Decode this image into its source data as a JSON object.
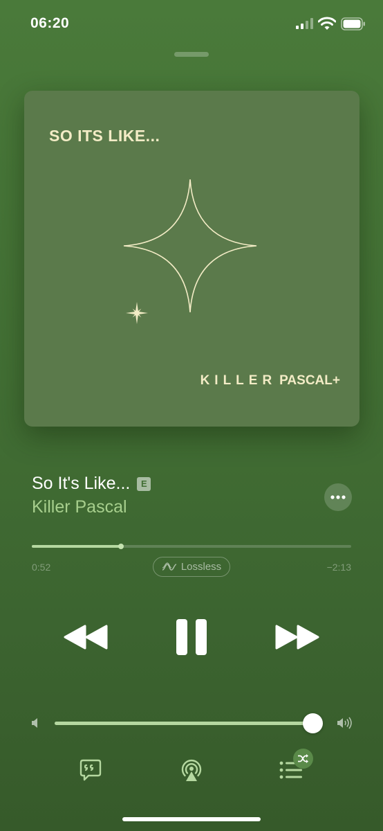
{
  "status_bar": {
    "time": "06:20",
    "icons": [
      "cellular-signal-icon",
      "wifi-icon",
      "battery-icon"
    ]
  },
  "artwork": {
    "title": "SO ITS LIKE...",
    "artist_part1": "KILLER",
    "artist_part2": "PASCAL",
    "artist_suffix": "+",
    "background_color": "#5b7a4b",
    "text_color": "#f3ecc6"
  },
  "track": {
    "title": "So It's Like...",
    "explicit_label": "E",
    "artist": "Killer Pascal"
  },
  "playback": {
    "elapsed": "0:52",
    "remaining": "−2:13",
    "progress_fraction": 0.28,
    "quality_label": "Lossless"
  },
  "volume": {
    "level_fraction": 0.995
  },
  "controls": {
    "icons": [
      "rewind-icon",
      "pause-icon",
      "fast-forward-icon",
      "lyrics-icon",
      "airplay-icon",
      "queue-icon",
      "shuffle-icon",
      "more-icon"
    ]
  },
  "colors": {
    "background": "#426f34",
    "accent": "#a7cf8d",
    "progress_fill": "#b5d8a0"
  }
}
